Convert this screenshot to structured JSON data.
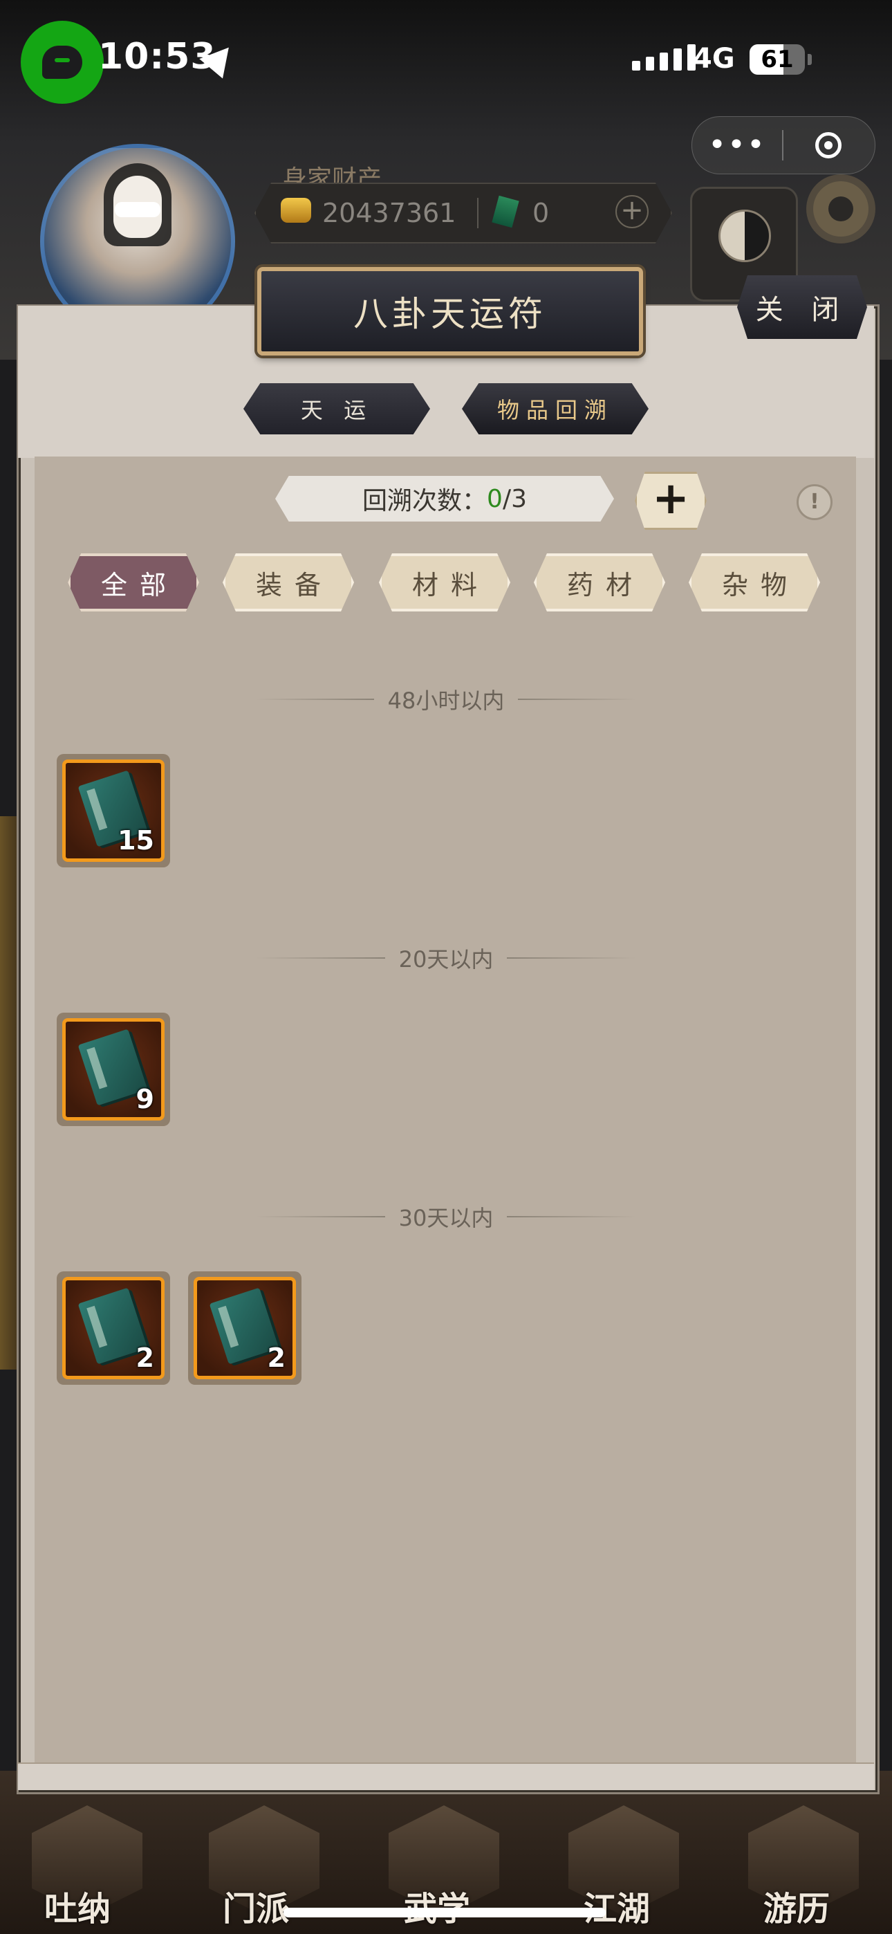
{
  "status_bar": {
    "time": "10:53",
    "network": "4G",
    "battery": "61",
    "battery_level": 0.61
  },
  "header": {
    "wealth_label": "身家财产",
    "gold": "20437361",
    "jade": "0"
  },
  "dialog": {
    "title": "八卦天运符",
    "close_label": "关 闭",
    "tabs": [
      {
        "label": "天 运",
        "active": false
      },
      {
        "label": "物品回溯",
        "active": true
      }
    ],
    "recall": {
      "label": "回溯次数：",
      "current": "0",
      "total": "/3"
    },
    "filters": [
      {
        "label": "全部",
        "active": true
      },
      {
        "label": "装备",
        "active": false
      },
      {
        "label": "材料",
        "active": false
      },
      {
        "label": "药材",
        "active": false
      },
      {
        "label": "杂物",
        "active": false
      }
    ],
    "sections": [
      {
        "title": "48小时以内",
        "items": [
          {
            "count": "15"
          }
        ]
      },
      {
        "title": "20天以内",
        "items": [
          {
            "count": "9"
          }
        ]
      },
      {
        "title": "30天以内",
        "items": [
          {
            "count": "2"
          },
          {
            "count": "2"
          }
        ]
      }
    ]
  },
  "bottom_nav": [
    "吐纳",
    "门派",
    "武学",
    "江湖",
    "游历"
  ],
  "colors": {
    "accent_active_filter": "#7e5a64",
    "item_border": "#f39a1c",
    "recall_current": "#2e8a1e"
  }
}
